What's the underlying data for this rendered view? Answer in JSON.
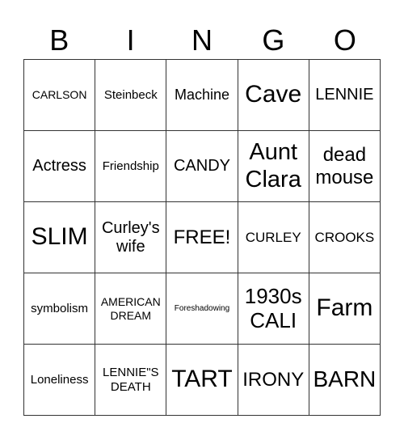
{
  "header": [
    "B",
    "I",
    "N",
    "G",
    "O"
  ],
  "cells": [
    [
      "CARLSON",
      "Steinbeck",
      "Machine",
      "Cave",
      "LENNIE"
    ],
    [
      "Actress",
      "Friendship",
      "CANDY",
      "Aunt Clara",
      "dead mouse"
    ],
    [
      "SLIM",
      "Curley's wife",
      "FREE!",
      "CURLEY",
      "CROOKS"
    ],
    [
      "symbolism",
      "AMERICAN DREAM",
      "Foreshadowing",
      "1930s CALI",
      "Farm"
    ],
    [
      "Loneliness",
      "LENNIE\"S DEATH",
      "TART",
      "IRONY",
      "BARN"
    ]
  ]
}
